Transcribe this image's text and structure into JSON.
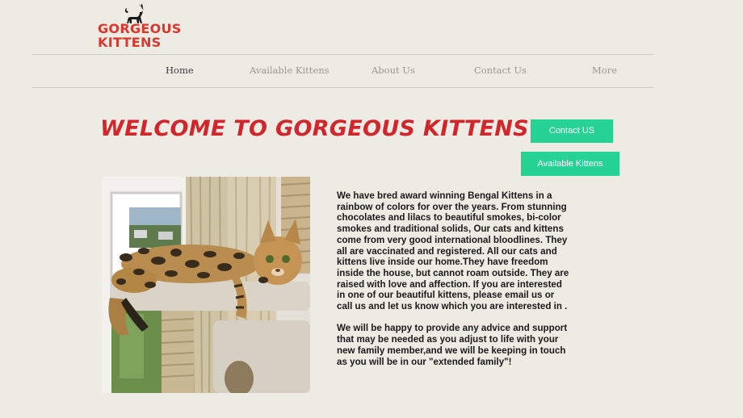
{
  "logo": {
    "line1": "GORGEOUS",
    "line2": "KITTENS",
    "icon": "cat-silhouette-icon",
    "color": "#d9382e"
  },
  "nav": {
    "items": [
      {
        "label": "Home",
        "active": true
      },
      {
        "label": "Available Kittens",
        "active": false
      },
      {
        "label": "About Us",
        "active": false
      },
      {
        "label": "Contact Us",
        "active": false
      },
      {
        "label": "More",
        "active": false
      }
    ]
  },
  "main": {
    "headline": "WELCOME TO GORGEOUS KITTENS",
    "contact_button": "Contact US",
    "available_button": "Available Kittens",
    "photo": "bengal-kitten-on-cat-tree",
    "paragraphs": [
      "We have bred award winning Bengal Kittens in a rainbow of colors for over the years. From stunning chocolates and lilacs to beautiful smokes, bi-color smokes and traditional solids, Our cats and kittens come from very good international bloodlines. They all are vaccinated and registered. All our cats and kittens live inside our home.They have freedom inside the house, but cannot roam outside. They are raised with love and affection. If you are interested in one of our beautiful kittens, please email us or call us and let us know which you are interested in .",
      "We will be happy to provide any advice and support that may be needed as you adjust to life with your new family member,and we will be keeping in touch as you will be in our \"extended family\"!"
    ]
  },
  "colors": {
    "background": "#eeebe4",
    "accent_red": "#d0262c",
    "button_green": "#27d295"
  }
}
